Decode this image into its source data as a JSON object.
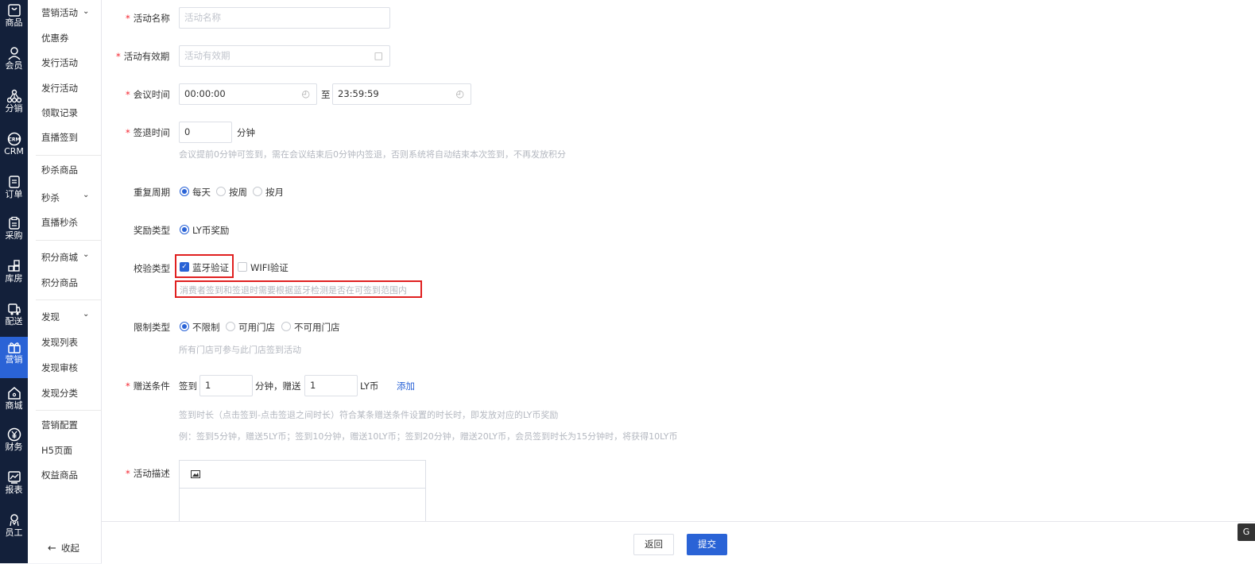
{
  "primary_nav": [
    {
      "label": "商品",
      "icon": "bag-icon",
      "active": false
    },
    {
      "label": "会员",
      "icon": "user-icon",
      "active": false
    },
    {
      "label": "分销",
      "icon": "network-icon",
      "active": false
    },
    {
      "label": "CRM",
      "icon": "crm-icon",
      "active": false
    },
    {
      "label": "订单",
      "icon": "document-icon",
      "active": false
    },
    {
      "label": "采购",
      "icon": "clipboard-icon",
      "active": false
    },
    {
      "label": "库房",
      "icon": "warehouse-icon",
      "active": false
    },
    {
      "label": "配送",
      "icon": "delivery-icon",
      "active": false
    },
    {
      "label": "营销",
      "icon": "gift-icon",
      "active": true
    },
    {
      "label": "商城",
      "icon": "home-icon",
      "active": false
    },
    {
      "label": "财务",
      "icon": "yen-icon",
      "active": false
    },
    {
      "label": "报表",
      "icon": "chart-icon",
      "active": false
    },
    {
      "label": "员工",
      "icon": "staff-icon",
      "active": false
    }
  ],
  "secondary_nav": {
    "items": [
      "营销活动",
      "优惠券",
      "发行活动",
      "发行活动",
      "领取记录",
      "直播签到",
      "秒杀商品",
      "秒杀",
      "直播秒杀",
      "积分商城",
      "积分商品",
      "发现",
      "发现列表",
      "发现审核",
      "发现分类",
      "营销配置",
      "H5页面",
      "权益商品"
    ],
    "collapse_label": "收起"
  },
  "form": {
    "activity_name": {
      "label": "活动名称",
      "placeholder": "活动名称"
    },
    "activity_period": {
      "label": "活动有效期",
      "placeholder": "活动有效期"
    },
    "meeting_time": {
      "label": "会议时间",
      "start": "00:00:00",
      "separator": "至",
      "end": "23:59:59"
    },
    "checkout_time": {
      "label": "签退时间",
      "value": "0",
      "unit": "分钟",
      "hint": "会议提前0分钟可签到，需在会议结束后0分钟内签退，否则系统将自动结束本次签到，不再发放积分"
    },
    "repeat_cycle": {
      "label": "重复周期",
      "options": [
        "每天",
        "按周",
        "按月"
      ],
      "selected": "每天"
    },
    "reward_type": {
      "label": "奖励类型",
      "options": [
        "LY币奖励"
      ],
      "selected": "LY币奖励"
    },
    "verify_type": {
      "label": "校验类型",
      "options": [
        "蓝牙验证",
        "WIFI验证"
      ],
      "checked": [
        "蓝牙验证"
      ],
      "hint": "消费者签到和签退时需要根据蓝牙检测是否在可签到范围内"
    },
    "restriction_type": {
      "label": "限制类型",
      "options": [
        "不限制",
        "可用门店",
        "不可用门店"
      ],
      "selected": "不限制",
      "hint": "所有门店可参与此门店签到活动"
    },
    "gift_condition": {
      "label": "赠送条件",
      "prefix": "签到",
      "minutes_value": "1",
      "mid_text": "分钟，赠送",
      "coins_value": "1",
      "unit": "LY币",
      "add_label": "添加",
      "hint1": "签到时长（点击签到-点击签退之间时长）符合某条赠送条件设置的时长时，即发放对应的LY币奖励",
      "hint2": "例：签到5分钟，赠送5LY币；签到10分钟，赠送10LY币；签到20分钟，赠送20LY币，会员签到时长为15分钟时，将获得10LY币"
    },
    "activity_description": {
      "label": "活动描述"
    }
  },
  "footer": {
    "back_label": "返回",
    "submit_label": "提交"
  },
  "corner_tab_label": "G"
}
